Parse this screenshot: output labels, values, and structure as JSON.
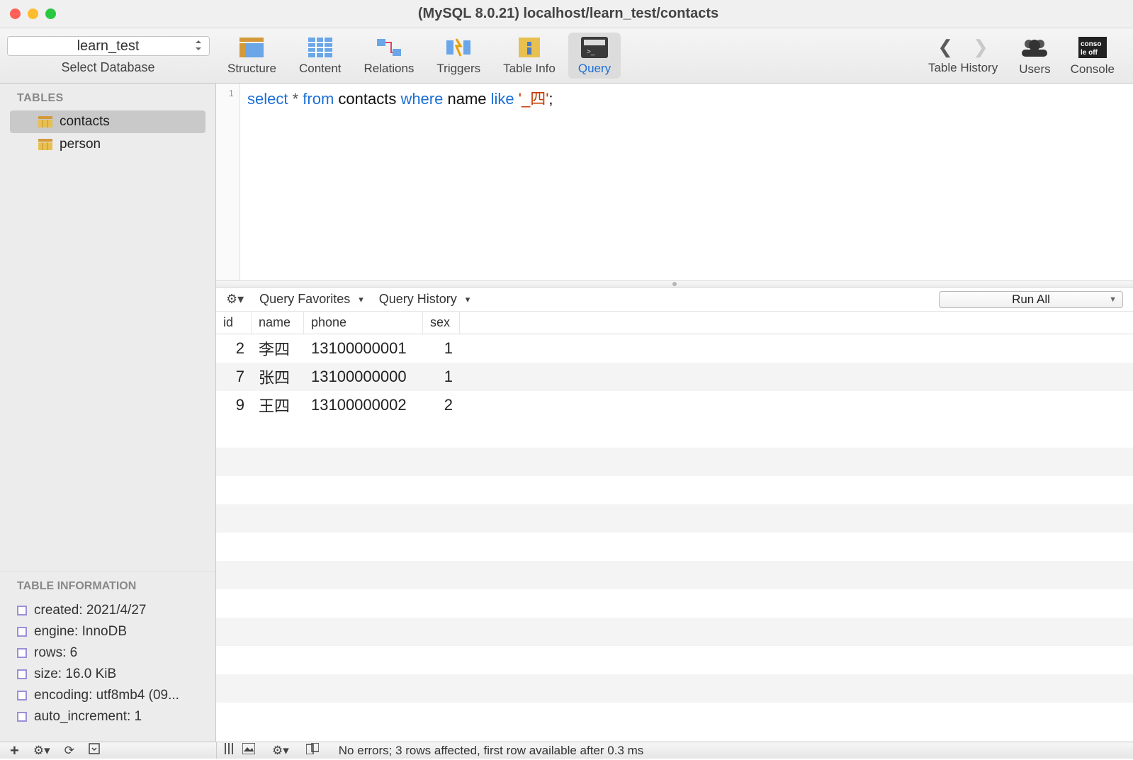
{
  "title": "(MySQL 8.0.21) localhost/learn_test/contacts",
  "db_selector": {
    "value": "learn_test",
    "label": "Select Database"
  },
  "toolbar": {
    "tabs": [
      {
        "id": "structure",
        "label": "Structure"
      },
      {
        "id": "content",
        "label": "Content"
      },
      {
        "id": "relations",
        "label": "Relations"
      },
      {
        "id": "triggers",
        "label": "Triggers"
      },
      {
        "id": "tableinfo",
        "label": "Table Info"
      },
      {
        "id": "query",
        "label": "Query"
      }
    ],
    "history_label": "Table History",
    "users_label": "Users",
    "console_label": "Console"
  },
  "sidebar": {
    "tables_header": "TABLES",
    "tables": [
      {
        "name": "contacts",
        "selected": true
      },
      {
        "name": "person",
        "selected": false
      }
    ],
    "info_header": "TABLE INFORMATION",
    "info": [
      "created: 2021/4/27",
      "engine: InnoDB",
      "rows: 6",
      "size: 16.0 KiB",
      "encoding: utf8mb4 (09...",
      "auto_increment: 1"
    ]
  },
  "query": {
    "line_number": "1",
    "tokens": {
      "select": "select",
      "star": " * ",
      "from": "from",
      "table": " contacts ",
      "where": "where",
      "col": " name ",
      "like": "like",
      "sp": " ",
      "str": "'_四'",
      "semi": ";"
    }
  },
  "mid": {
    "favorites": "Query Favorites",
    "history": "Query History",
    "run_all": "Run All"
  },
  "results": {
    "columns": [
      "id",
      "name",
      "phone",
      "sex"
    ],
    "rows": [
      {
        "id": "2",
        "name": "李四",
        "phone": "13100000001",
        "sex": "1"
      },
      {
        "id": "7",
        "name": "张四",
        "phone": "13100000000",
        "sex": "1"
      },
      {
        "id": "9",
        "name": "王四",
        "phone": "13100000002",
        "sex": "2"
      }
    ]
  },
  "status": "No errors; 3 rows affected, first row available after 0.3 ms"
}
